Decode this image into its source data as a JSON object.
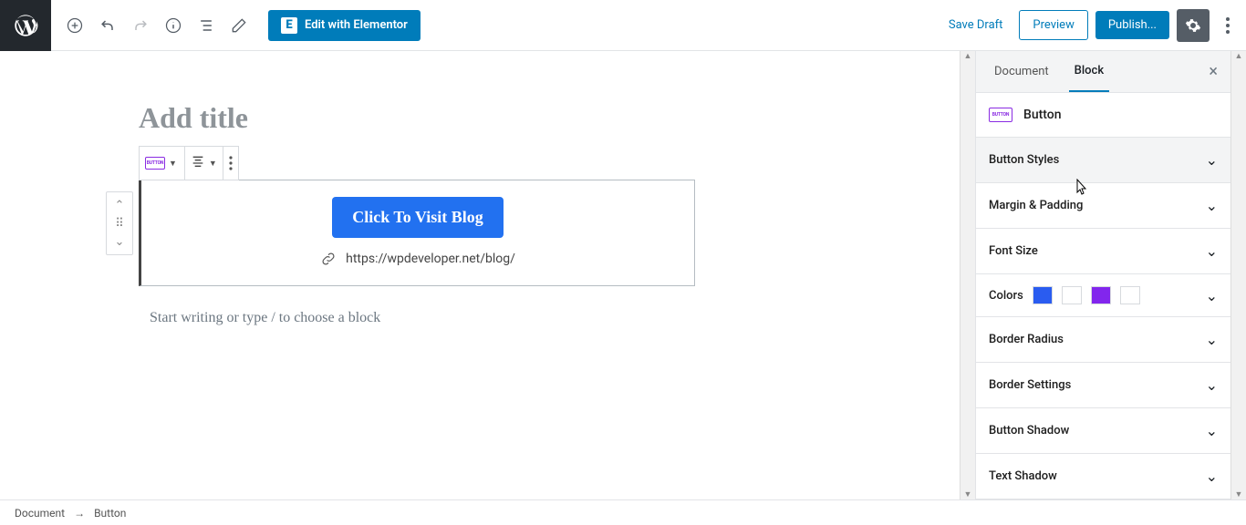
{
  "toolbar": {
    "elementor_label": "Edit with Elementor",
    "save_draft": "Save Draft",
    "preview": "Preview",
    "publish": "Publish..."
  },
  "editor": {
    "title_placeholder": "Add title",
    "button_text": "Click To Visit Blog",
    "button_link": "https://wpdeveloper.net/blog/",
    "writing_placeholder": "Start writing or type / to choose a block"
  },
  "sidebar": {
    "tabs": {
      "document": "Document",
      "block": "Block"
    },
    "block_name": "Button",
    "panels": {
      "styles": "Button Styles",
      "margin": "Margin & Padding",
      "fontsize": "Font Size",
      "colors_label": "Colors",
      "colors": {
        "fg": "#2a5cf0",
        "bg": "#ffffff",
        "accent": "#8226ed",
        "accent_bg": "#ffffff"
      },
      "radius": "Border Radius",
      "border": "Border Settings",
      "shadow": "Button Shadow",
      "textshadow": "Text Shadow"
    }
  },
  "breadcrumb": {
    "doc": "Document",
    "block": "Button"
  }
}
